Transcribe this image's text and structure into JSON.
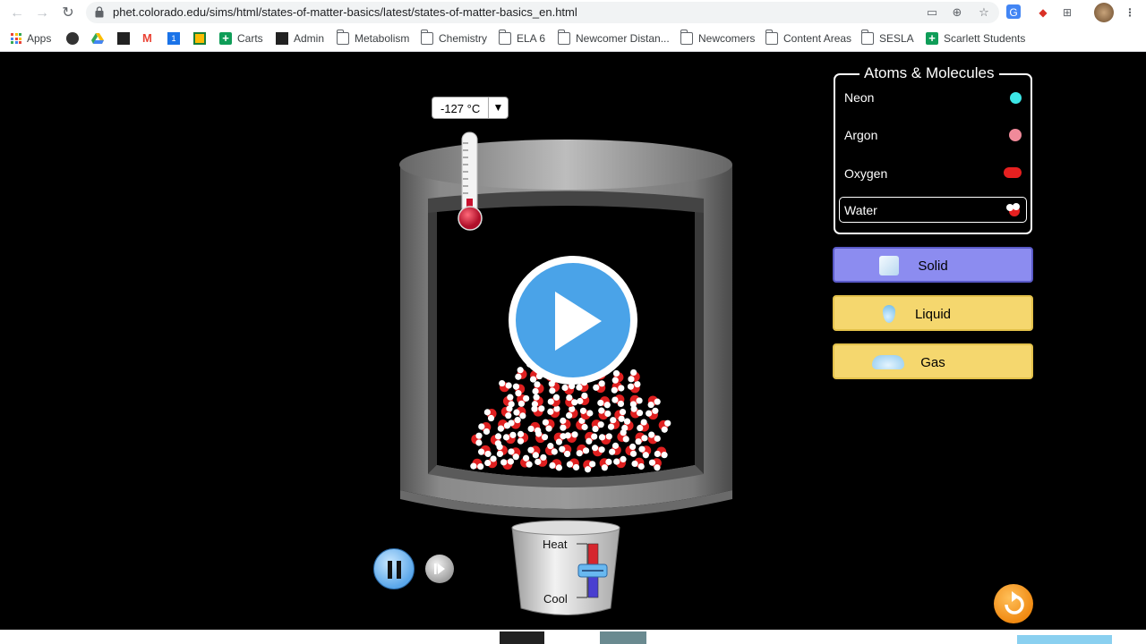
{
  "browser": {
    "url": "phet.colorado.edu/sims/html/states-of-matter-basics/latest/states-of-matter-basics_en.html",
    "bookmarks": [
      {
        "label": "Apps",
        "icon": "apps-grid-icon"
      },
      {
        "label": "",
        "icon": "globe-icon"
      },
      {
        "label": "",
        "icon": "drive-icon"
      },
      {
        "label": "",
        "icon": "bookmark-p-icon"
      },
      {
        "label": "",
        "icon": "gmail-icon"
      },
      {
        "label": "",
        "icon": "calendar-icon"
      },
      {
        "label": "",
        "icon": "classroom-icon"
      },
      {
        "label": "Carts",
        "icon": "plus-icon"
      },
      {
        "label": "Admin",
        "icon": "bookmark-p-icon"
      },
      {
        "label": "Metabolism",
        "icon": "folder-icon"
      },
      {
        "label": "Chemistry",
        "icon": "folder-icon"
      },
      {
        "label": "ELA 6",
        "icon": "folder-icon"
      },
      {
        "label": "Newcomer Distan...",
        "icon": "folder-icon"
      },
      {
        "label": "Newcomers",
        "icon": "folder-icon"
      },
      {
        "label": "Content Areas",
        "icon": "folder-icon"
      },
      {
        "label": "SESLA",
        "icon": "folder-icon"
      },
      {
        "label": "Scarlett Students",
        "icon": "plus-icon"
      }
    ]
  },
  "sim": {
    "temperature": "-127 °C",
    "atoms_panel": {
      "title": "Atoms & Molecules",
      "items": [
        {
          "label": "Neon",
          "color": "#3ce6e6"
        },
        {
          "label": "Argon",
          "color": "#f08a8a"
        },
        {
          "label": "Oxygen",
          "color": "#e62020"
        },
        {
          "label": "Water",
          "color": "#e62020"
        }
      ],
      "selected": "Water"
    },
    "phases": [
      {
        "label": "Solid",
        "color": "#8c8cf0"
      },
      {
        "label": "Liquid",
        "color": "#f5d76e"
      },
      {
        "label": "Gas",
        "color": "#f5d76e"
      }
    ],
    "heater": {
      "heat_label": "Heat",
      "cool_label": "Cool"
    }
  }
}
